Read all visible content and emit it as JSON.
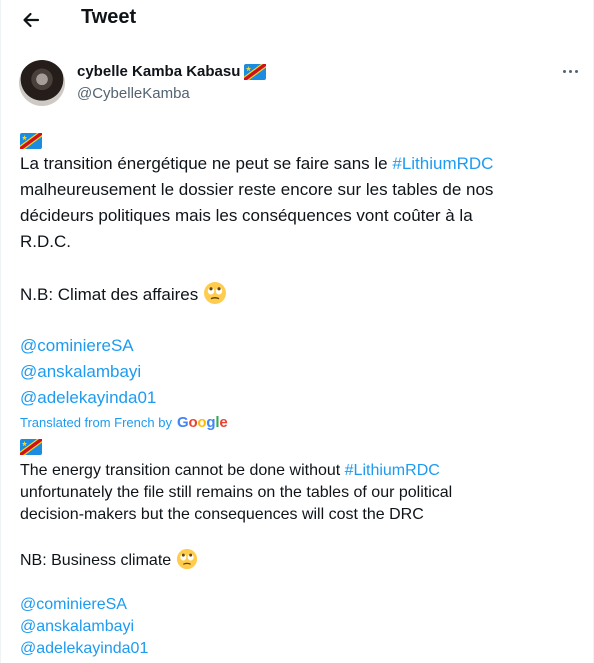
{
  "header": {
    "title": "Tweet"
  },
  "author": {
    "name": "cybelle Kamba Kabasu",
    "handle": "@CybelleKamba"
  },
  "original": {
    "line1_prefix": "La transition énergétique ne peut se faire sans le ",
    "hashtag": "#LithiumRDC",
    "line2": "malheureusement le dossier reste encore sur les tables de nos",
    "line3": "décideurs politiques mais les conséquences vont coûter à la",
    "line4": "R.D.C.",
    "nb": "N.B:  Climat des affaires",
    "mentions": [
      "@cominiereSA",
      "@anskalambayi",
      "@adelekayinda01"
    ]
  },
  "translation": {
    "label": "Translated from French by",
    "provider": "Google",
    "line1_prefix": "The energy transition cannot be done without ",
    "hashtag": "#LithiumRDC",
    "line2": "unfortunately the file still remains on the tables of our political",
    "line3": "decision-makers but the consequences will cost the DRC",
    "nb": "NB: Business climate",
    "mentions": [
      "@cominiereSA",
      "@anskalambayi",
      "@adelekayinda01"
    ]
  },
  "icons": {
    "back": "arrow-left-icon",
    "more": "more-horizontal-icon",
    "flag": "flag-dr-congo",
    "emoji": "face-with-rolling-eyes"
  },
  "colors": {
    "link": "#1d9bf0",
    "text": "#0f1419",
    "muted": "#536471"
  }
}
